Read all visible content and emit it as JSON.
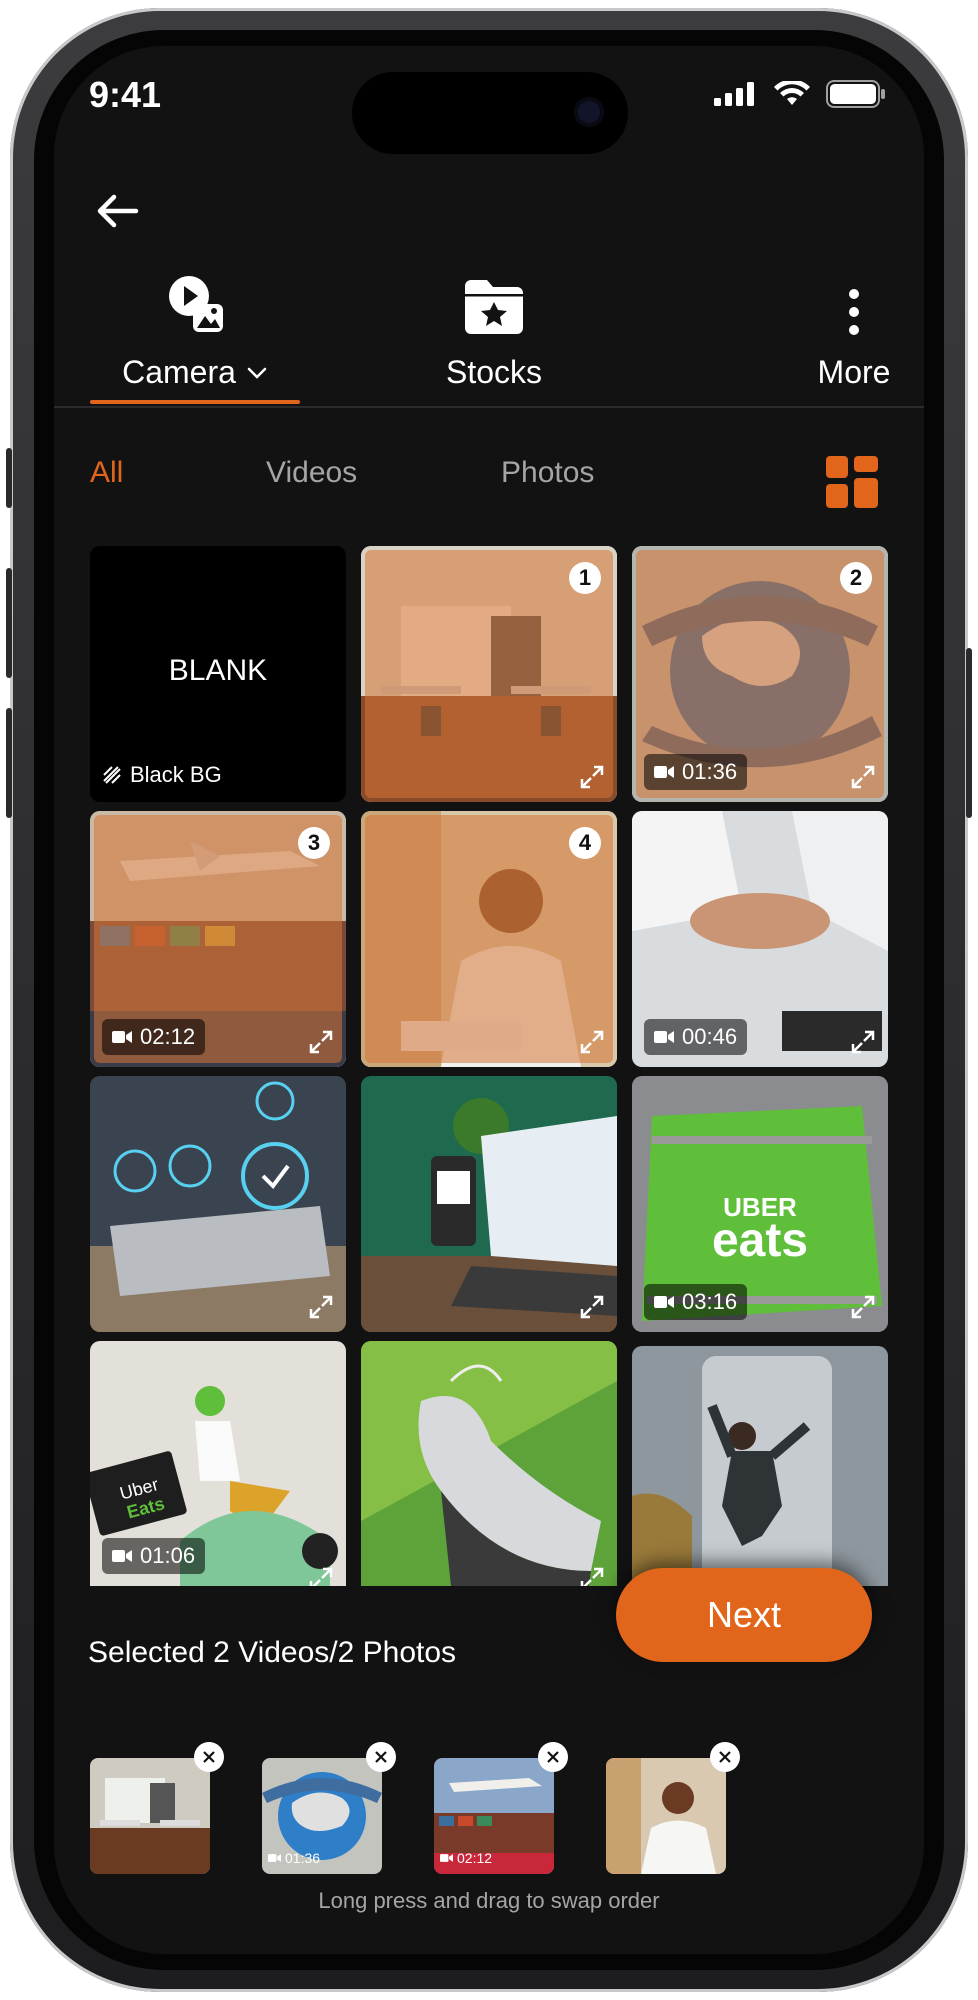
{
  "status_bar": {
    "time": "9:41"
  },
  "header": {
    "back_icon": "arrow-left-icon"
  },
  "source_tabs": [
    {
      "label": "Camera",
      "icon": "camera-gallery-icon",
      "active": true,
      "has_dropdown": true
    },
    {
      "label": "Stocks",
      "icon": "star-folder-icon",
      "active": false
    },
    {
      "label": "More",
      "icon": "more-vertical-icon",
      "active": false
    }
  ],
  "filters": [
    {
      "label": "All",
      "active": true
    },
    {
      "label": "Videos",
      "active": false
    },
    {
      "label": "Photos",
      "active": false
    }
  ],
  "grid": {
    "blank_tile": {
      "title": "BLANK",
      "subtitle": "Black BG"
    },
    "tiles": [
      {
        "kind": "photo",
        "subject": "office",
        "selected": true,
        "order": "1"
      },
      {
        "kind": "video",
        "subject": "globe-import-export",
        "selected": true,
        "order": "2",
        "duration": "01:36"
      },
      {
        "kind": "video",
        "subject": "cargo-plane-ship",
        "selected": true,
        "order": "3",
        "duration": "02:12"
      },
      {
        "kind": "photo",
        "subject": "pharmacist",
        "selected": true,
        "order": "4"
      },
      {
        "kind": "video",
        "subject": "team-hands",
        "selected": false,
        "duration": "00:46"
      },
      {
        "kind": "photo",
        "subject": "laptop-tech",
        "selected": false
      },
      {
        "kind": "photo",
        "subject": "qr-laptop",
        "selected": false
      },
      {
        "kind": "video",
        "subject": "uber-eats-bag",
        "selected": false,
        "duration": "03:16"
      },
      {
        "kind": "video",
        "subject": "uber-eats-scooter",
        "selected": false,
        "duration": "01:06"
      },
      {
        "kind": "photo",
        "subject": "sneaker",
        "selected": false
      },
      {
        "kind": "photo",
        "subject": "jumping-man",
        "selected": false
      }
    ]
  },
  "next_button": {
    "label": "Next"
  },
  "selection": {
    "summary": "Selected 2 Videos/2 Photos",
    "thumbs": [
      {
        "subject": "office"
      },
      {
        "subject": "globe-import-export",
        "duration": "01:36"
      },
      {
        "subject": "cargo-plane-ship",
        "duration": "02:12"
      },
      {
        "subject": "pharmacist"
      }
    ],
    "hint": "Long press and drag to swap order"
  },
  "colors": {
    "accent": "#e1651b",
    "background": "#121212",
    "muted_text": "#a5a5a5"
  }
}
